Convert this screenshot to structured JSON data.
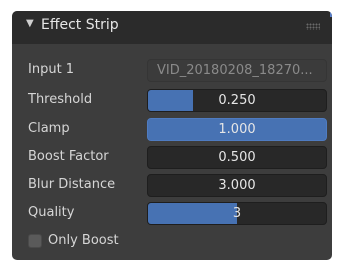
{
  "panel": {
    "title": "Effect Strip",
    "caret_icon": "▼"
  },
  "fields": {
    "input1": {
      "label": "Input 1",
      "value": "VID_20180208_18270..."
    },
    "threshold": {
      "label": "Threshold",
      "value": "0.250",
      "fill_fraction": 0.25
    },
    "clamp": {
      "label": "Clamp",
      "value": "1.000",
      "fill_fraction": 1.0
    },
    "boost_factor": {
      "label": "Boost Factor",
      "value": "0.500"
    },
    "blur_distance": {
      "label": "Blur Distance",
      "value": "3.000"
    },
    "quality": {
      "label": "Quality",
      "value": "3",
      "fill_fraction": 0.5
    }
  },
  "only_boost": {
    "label": "Only Boost",
    "checked": false
  },
  "colors": {
    "accent": "#4772b3",
    "panel_bg": "#3d3d3d",
    "header_bg": "#2b2b2b",
    "field_bg": "#282828"
  }
}
